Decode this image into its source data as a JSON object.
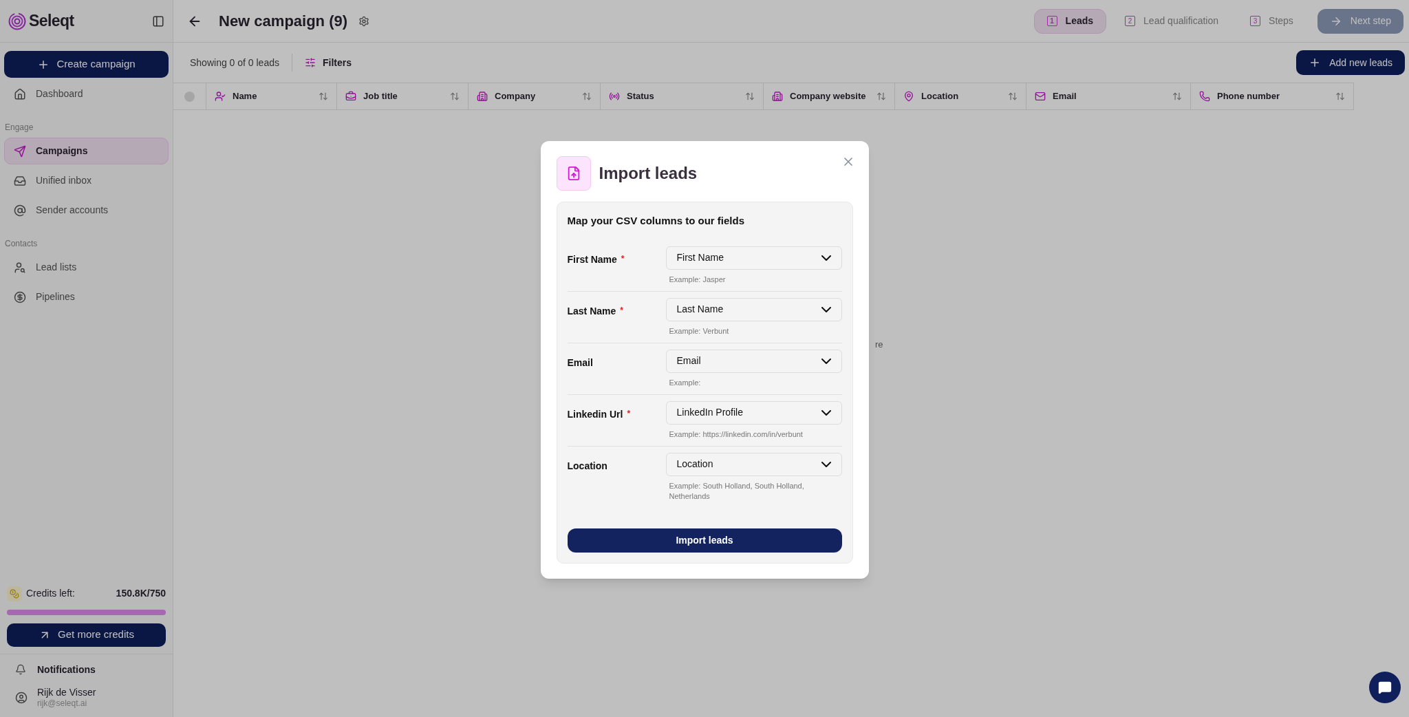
{
  "sidebar": {
    "logo": "Seleqt",
    "create_button": "Create campaign",
    "sections": [
      {
        "items": [
          {
            "label": "Dashboard",
            "selected": false
          }
        ]
      },
      {
        "heading": "Engage",
        "items": [
          {
            "label": "Campaigns",
            "selected": true
          },
          {
            "label": "Unified inbox",
            "selected": false
          },
          {
            "label": "Sender accounts",
            "selected": false
          }
        ]
      },
      {
        "heading": "Contacts",
        "items": [
          {
            "label": "Lead lists",
            "selected": false
          },
          {
            "label": "Pipelines",
            "selected": false
          }
        ]
      }
    ],
    "credits": {
      "label": "Credits left:",
      "value": "150.8K/750",
      "level": 1
    },
    "credits_button": "Get more credits",
    "notifications": "Notifications",
    "user": {
      "name": "Rijk de Visser",
      "email": "rijk@seleqt.ai"
    }
  },
  "header": {
    "title": "New campaign (9)",
    "steps": [
      {
        "number": "1",
        "label": "Leads",
        "selected": true
      },
      {
        "number": "2",
        "label": "Lead qualification",
        "selected": false
      },
      {
        "number": "3",
        "label": "Steps",
        "selected": false
      }
    ],
    "next_button": "Next step"
  },
  "toolbar": {
    "count": "Showing 0 of 0 leads",
    "filters": "Filters",
    "add_button": "Add new leads"
  },
  "table": {
    "select_all": {
      "checked": false
    },
    "columns": [
      {
        "label": "Name"
      },
      {
        "label": "Job title"
      },
      {
        "label": "Company"
      },
      {
        "label": "Status"
      },
      {
        "label": "Company website"
      },
      {
        "label": "Location"
      },
      {
        "label": "Email"
      },
      {
        "label": "Phone number"
      }
    ],
    "empty_text": "re"
  },
  "modal": {
    "title": "Import leads",
    "subtitle": "Map your CSV columns to our fields",
    "required_mark": "*",
    "fields": [
      {
        "label": "First Name",
        "required": true,
        "value": "First Name",
        "example": "Example: Jasper"
      },
      {
        "label": "Last Name",
        "required": true,
        "value": "Last Name",
        "example": "Example: Verbunt"
      },
      {
        "label": "Email",
        "required": false,
        "value": "Email",
        "example": "Example:"
      },
      {
        "label": "Linkedin Url",
        "required": true,
        "value": "LinkedIn Profile",
        "example": "Example: https://linkedin.com/in/verbunt"
      },
      {
        "label": "Location",
        "required": false,
        "value": "Location",
        "example": "Example: South Holland, South Holland, Netherlands"
      }
    ],
    "submit": "Import leads"
  }
}
